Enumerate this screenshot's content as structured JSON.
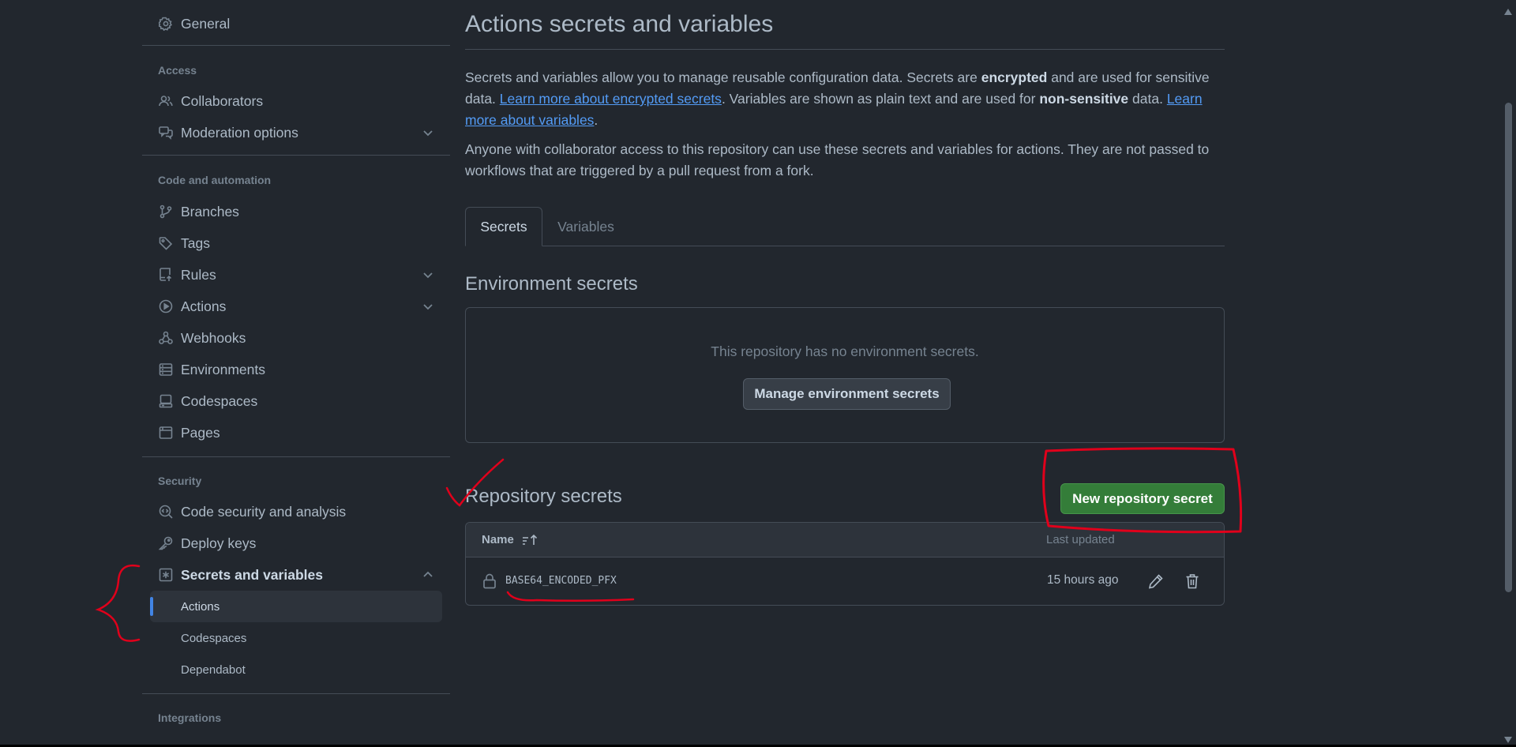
{
  "sidebar": {
    "general": "General",
    "access_title": "Access",
    "collaborators": "Collaborators",
    "moderation": "Moderation options",
    "code_title": "Code and automation",
    "branches": "Branches",
    "tags": "Tags",
    "rules": "Rules",
    "actions": "Actions",
    "webhooks": "Webhooks",
    "environments": "Environments",
    "codespaces": "Codespaces",
    "pages": "Pages",
    "security_title": "Security",
    "code_security": "Code security and analysis",
    "deploy_keys": "Deploy keys",
    "secrets_vars": "Secrets and variables",
    "sub_actions": "Actions",
    "sub_codespaces": "Codespaces",
    "sub_dependabot": "Dependabot",
    "integrations_title": "Integrations"
  },
  "main": {
    "title": "Actions secrets and variables",
    "intro": {
      "p1": "Secrets and variables allow you to manage reusable configuration data. Secrets are ",
      "b1": "encrypted",
      "p2": " and are used for sensitive data. ",
      "link1": "Learn more about encrypted secrets",
      "p3": ". Variables are shown as plain text and are used for ",
      "b2": "non-sensitive",
      "p4": " data. ",
      "link2": "Learn more about variables",
      "p5": "."
    },
    "access_note": "Anyone with collaborator access to this repository can use these secrets and variables for actions. They are not passed to workflows that are triggered by a pull request from a fork.",
    "tabs": [
      "Secrets",
      "Variables"
    ],
    "env_heading": "Environment secrets",
    "env_empty": "This repository has no environment secrets.",
    "manage_button": "Manage environment secrets",
    "repo_heading": "Repository secrets",
    "new_secret_button": "New repository secret",
    "table": {
      "col_name": "Name",
      "col_updated": "Last updated",
      "rows": [
        {
          "name": "BASE64_ENCODED_PFX",
          "updated": "15 hours ago"
        }
      ]
    }
  },
  "colors": {
    "background": "#22272e",
    "accent_link": "#539bf5",
    "primary_button": "#347d39",
    "annotation": "#e0001b"
  }
}
